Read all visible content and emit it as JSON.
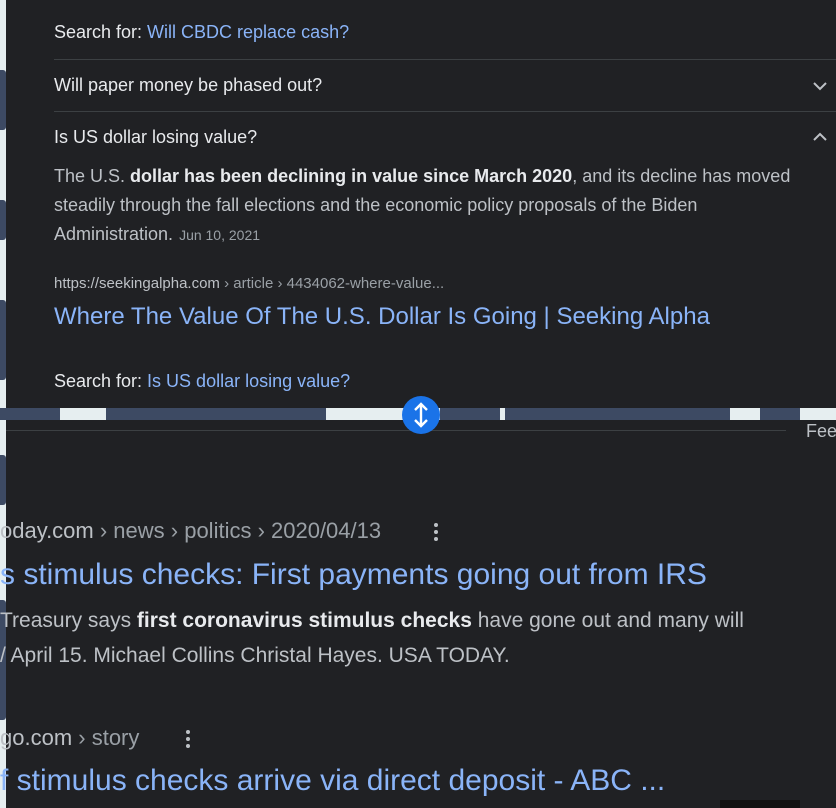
{
  "panel": {
    "search_prefix": "Search for: ",
    "search_link_1": "Will CBDC replace cash?",
    "q_paper_money": "Will paper money be phased out?",
    "q_us_dollar": "Is US dollar losing value?",
    "answer_a": "The U.S. ",
    "answer_b": "dollar has been declining in value since March 2020",
    "answer_c": ", and its decline has moved steadily through the fall elections and the economic policy proposals of the Biden Administration.",
    "answer_date": "Jun 10, 2021",
    "cite_domain": "https://seekingalpha.com",
    "cite_path": " › article › 4434062-where-value...",
    "result_title": "Where The Value Of The U.S. Dollar Is Going | Seeking Alpha",
    "search_prefix_2": "Search for: ",
    "search_link_2": "Is US dollar losing value?"
  },
  "map": {
    "fee_label": "Fee"
  },
  "results": [
    {
      "url_host": "oday.com",
      "url_crumbs": " › news › politics › 2020/04/13",
      "title": "s stimulus checks: First payments going out from IRS",
      "snippet_a": " Treasury says ",
      "snippet_b": "first coronavirus stimulus checks",
      "snippet_c": " have gone out and many will",
      "snippet_line2": "/ April 15. Michael Collins Christal Hayes. USA TODAY."
    },
    {
      "url_host": "go.com",
      "url_crumbs": " › story",
      "title": "f stimulus checks arrive via direct deposit - ABC ..."
    }
  ],
  "colors": {
    "link": "#8ab4f8",
    "background": "#202124",
    "accent": "#1a73e8"
  },
  "icons": [
    "chevron-down-icon",
    "chevron-up-icon",
    "vertical-resize-icon",
    "more-vert-icon"
  ]
}
